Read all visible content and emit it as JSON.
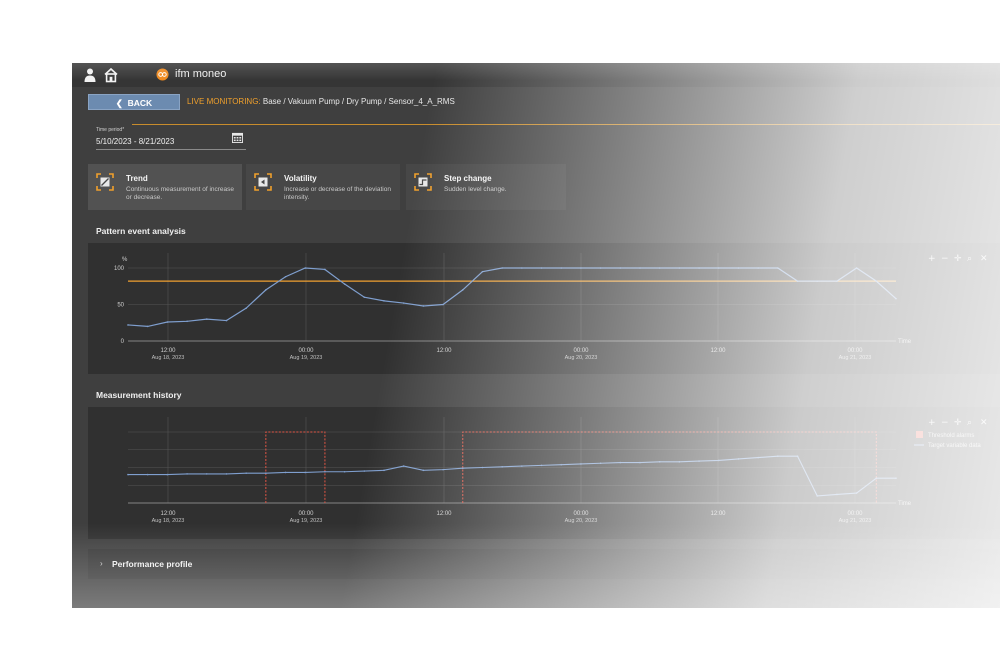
{
  "app": {
    "name": "ifm moneo"
  },
  "nav": {
    "back_label": "BACK",
    "section_label": "LIVE MONITORING:",
    "path": "Base / Vakuum Pump / Dry Pump / Sensor_4_A_RMS"
  },
  "time_period": {
    "label": "Time period*",
    "value": "5/10/2023 - 8/21/2023"
  },
  "tabs": [
    {
      "title": "Trend",
      "desc": "Continuous measurement of increase or decrease.",
      "active": true
    },
    {
      "title": "Volatility",
      "desc": "Increase or decrease of the deviation intensity.",
      "active": false
    },
    {
      "title": "Step change",
      "desc": "Sudden level change.",
      "active": false
    }
  ],
  "pattern_section": {
    "title": "Pattern event analysis"
  },
  "history_section": {
    "title": "Measurement history"
  },
  "bottom_section": {
    "title": "Performance profile"
  },
  "colors": {
    "series": "#7f9fcf",
    "threshold": "#f0a030",
    "alarm": "#e05545",
    "background": "#3f3f3f",
    "accent": "#f0a02c"
  },
  "chart_data": [
    {
      "type": "line",
      "title": "Pattern event analysis",
      "ylabel": "%",
      "xlabel": "Time",
      "ylim": [
        0,
        100
      ],
      "yticks": [
        "100",
        "50",
        "0"
      ],
      "xtick_labels": [
        {
          "time": "12:00",
          "date": "Aug 18, 2023"
        },
        {
          "time": "00:00",
          "date": "Aug 19, 2023"
        },
        {
          "time": "12:00",
          "date": ""
        },
        {
          "time": "00:00",
          "date": "Aug 20, 2023"
        },
        {
          "time": "12:00",
          "date": ""
        },
        {
          "time": "00:00",
          "date": "Aug 21, 2023"
        }
      ],
      "x_index": [
        0,
        1,
        2,
        3,
        4,
        5,
        6,
        7,
        8,
        9,
        10,
        11,
        12,
        13,
        14,
        15,
        16,
        17,
        18,
        19,
        20,
        21,
        22,
        23,
        24,
        25,
        26,
        27,
        28,
        29,
        30,
        31,
        32,
        33,
        34,
        35,
        36,
        37,
        38,
        39
      ],
      "series": [
        {
          "values": [
            22,
            20,
            26,
            27,
            30,
            28,
            45,
            70,
            88,
            100,
            98,
            78,
            60,
            55,
            52,
            48,
            50,
            70,
            95,
            100,
            100,
            100,
            100,
            100,
            100,
            100,
            100,
            100,
            100,
            100,
            100,
            100,
            100,
            100,
            82,
            82,
            82,
            100,
            82,
            58
          ]
        },
        {
          "values": [
            82,
            82,
            82,
            82,
            82,
            82,
            82,
            82,
            82,
            82,
            82,
            82,
            82,
            82,
            82,
            82,
            82,
            82,
            82,
            82,
            82,
            82,
            82,
            82,
            82,
            82,
            82,
            82,
            82,
            82,
            82,
            82,
            82,
            82,
            82,
            82,
            82,
            82,
            82,
            82
          ]
        }
      ],
      "legend_position": "top-right",
      "grid": true
    },
    {
      "type": "line",
      "title": "Measurement history",
      "xlabel": "Time",
      "xtick_labels": [
        {
          "time": "12:00",
          "date": "Aug 18, 2023"
        },
        {
          "time": "00:00",
          "date": "Aug 19, 2023"
        },
        {
          "time": "12:00",
          "date": ""
        },
        {
          "time": "00:00",
          "date": "Aug 20, 2023"
        },
        {
          "time": "12:00",
          "date": ""
        },
        {
          "time": "00:00",
          "date": "Aug 21, 2023"
        }
      ],
      "x_index": [
        0,
        1,
        2,
        3,
        4,
        5,
        6,
        7,
        8,
        9,
        10,
        11,
        12,
        13,
        14,
        15,
        16,
        17,
        18,
        19,
        20,
        21,
        22,
        23,
        24,
        25,
        26,
        27,
        28,
        29,
        30,
        31,
        32,
        33,
        34,
        35,
        36,
        37,
        38,
        39
      ],
      "ylim": [
        0,
        100
      ],
      "series": [
        {
          "name": "Target variable data",
          "values": [
            40,
            40,
            40,
            41,
            41,
            41,
            42,
            42,
            43,
            43,
            44,
            44,
            45,
            46,
            52,
            46,
            47,
            49,
            50,
            51,
            52,
            53,
            54,
            55,
            56,
            57,
            57,
            58,
            58,
            59,
            60,
            62,
            64,
            66,
            66,
            10,
            12,
            14,
            35,
            35
          ]
        }
      ],
      "alarm_bands": [
        [
          7,
          10
        ],
        [
          17,
          38
        ]
      ],
      "legend": [
        "Threshold alarms",
        "Target variable data"
      ],
      "legend_position": "top-right",
      "grid": true
    }
  ]
}
